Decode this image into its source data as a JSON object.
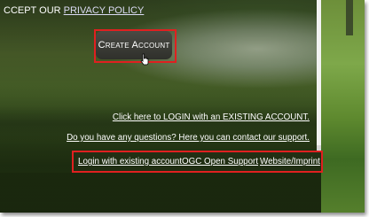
{
  "header": {
    "accept_text": "CCEPT OUR ",
    "privacy_link": "PRIVACY POLICY"
  },
  "main": {
    "create_account_label": "Create Account",
    "login_existing_link": "Click here to LOGIN with an EXISTING ACCOUNT.",
    "support_question_link": "Do you have any questions? Here you can contact our support."
  },
  "footer": {
    "links": [
      "Login with existing account",
      "OGC Open Support",
      "Website/Imprint"
    ]
  },
  "colors": {
    "highlight": "#e02020",
    "button_bg": "#2f302b",
    "link_text": "#ffffff"
  },
  "icons": {
    "cursor": "hand-pointer-icon"
  }
}
